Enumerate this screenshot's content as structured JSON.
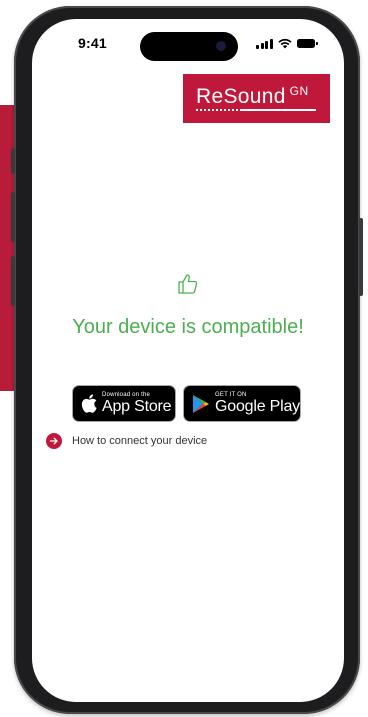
{
  "status_bar": {
    "time": "9:41"
  },
  "brand": {
    "logo_main": "ReSound",
    "logo_sup": "GN",
    "color": "#c0183a"
  },
  "main": {
    "icon": "thumbs-up-icon",
    "message": "Your device is compatible!",
    "message_color": "#4caf50"
  },
  "store_badges": {
    "app_store": {
      "small": "Download on the",
      "big": "App Store",
      "icon": "apple-icon"
    },
    "google_play": {
      "small": "GET IT ON",
      "big": "Google Play",
      "icon": "google-play-icon"
    }
  },
  "link": {
    "label": "How to connect your device",
    "icon": "arrow-right-icon"
  }
}
